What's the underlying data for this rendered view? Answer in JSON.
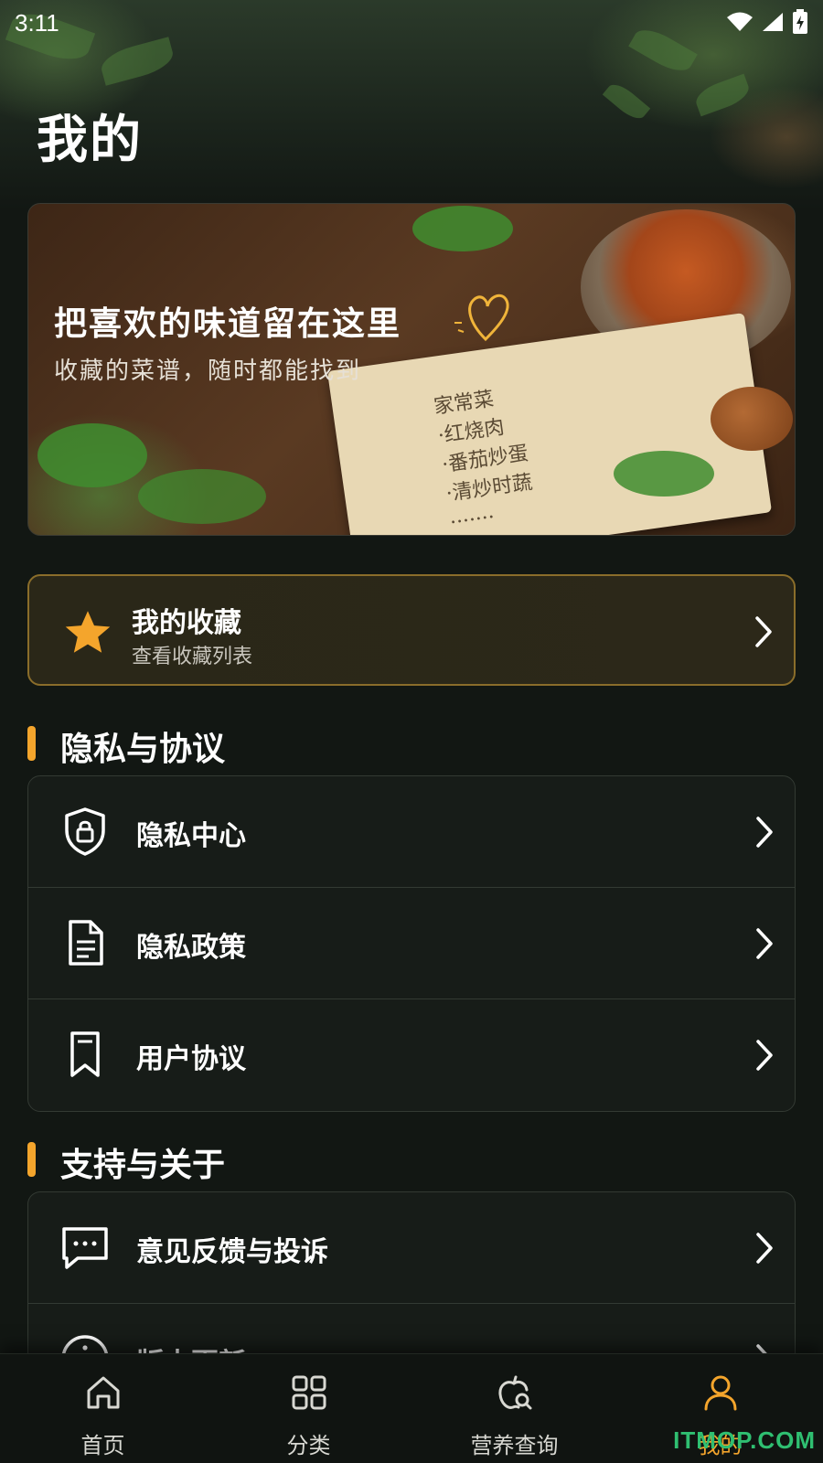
{
  "status_bar": {
    "time": "3:11"
  },
  "header": {
    "title": "我的"
  },
  "banner": {
    "title": "把喜欢的味道留在这里",
    "subtitle": "收藏的菜谱，随时都能找到",
    "notebook_lines": [
      "家常菜",
      "·红烧肉",
      "·番茄炒蛋",
      "·清炒时蔬",
      "·······"
    ]
  },
  "favorites": {
    "title": "我的收藏",
    "subtitle": "查看收藏列表"
  },
  "sections": {
    "privacy": {
      "title": "隐私与协议",
      "items": [
        {
          "label": "隐私中心",
          "icon": "shield-lock-icon"
        },
        {
          "label": "隐私政策",
          "icon": "document-icon"
        },
        {
          "label": "用户协议",
          "icon": "bookmark-icon"
        }
      ]
    },
    "support": {
      "title": "支持与关于",
      "items": [
        {
          "label": "意见反馈与投诉",
          "icon": "chat-bubble-icon"
        },
        {
          "label": "版本更新",
          "icon": "info-icon"
        }
      ]
    }
  },
  "bottom_nav": [
    {
      "label": "首页",
      "icon": "home-icon",
      "active": false
    },
    {
      "label": "分类",
      "icon": "grid-icon",
      "active": false
    },
    {
      "label": "营养查询",
      "icon": "apple-search-icon",
      "active": false
    },
    {
      "label": "我的",
      "icon": "person-icon",
      "active": true
    }
  ],
  "watermark": "ITMOP.COM",
  "colors": {
    "accent": "#f4a52c",
    "background": "#121713",
    "card_border": "#8a6d2a"
  }
}
